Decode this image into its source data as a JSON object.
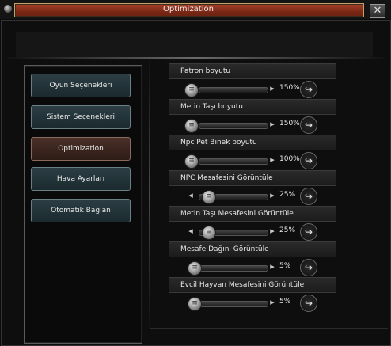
{
  "window": {
    "title": "Optimization",
    "close_icon": "✕"
  },
  "sidebar": {
    "items": [
      {
        "label": "Oyun Seçenekleri"
      },
      {
        "label": "Sistem Seçenekleri"
      },
      {
        "label": "Optimization",
        "active": true
      },
      {
        "label": "Hava Ayarları"
      },
      {
        "label": "Otomatik Bağlan"
      }
    ]
  },
  "options": [
    {
      "label": "Patron boyutu",
      "value": "150%",
      "level": 0
    },
    {
      "label": "Metin Taşı boyutu",
      "value": "150%",
      "level": 0
    },
    {
      "label": "Npc Pet Binek boyutu",
      "value": "100%",
      "level": 0
    },
    {
      "label": "NPC Mesafesini Görüntüle",
      "value": "25%",
      "level": 0.25
    },
    {
      "label": "Metin Taşı Mesafesini Görüntüle",
      "value": "25%",
      "level": 0.25
    },
    {
      "label": "Mesafe Dağını Görüntüle",
      "value": "5%",
      "level": 0.05
    },
    {
      "label": "Evcil Hayvan Mesafesini Görüntüle",
      "value": "5%",
      "level": 0.05
    }
  ],
  "icons": {
    "slider_knob": "≡",
    "arrow_left": "◂",
    "arrow_right": "▸",
    "reset": "↪"
  },
  "colors": {
    "title_bar": "#7a2816",
    "nav_button": "#1f3036",
    "nav_active": "#3a241c"
  }
}
